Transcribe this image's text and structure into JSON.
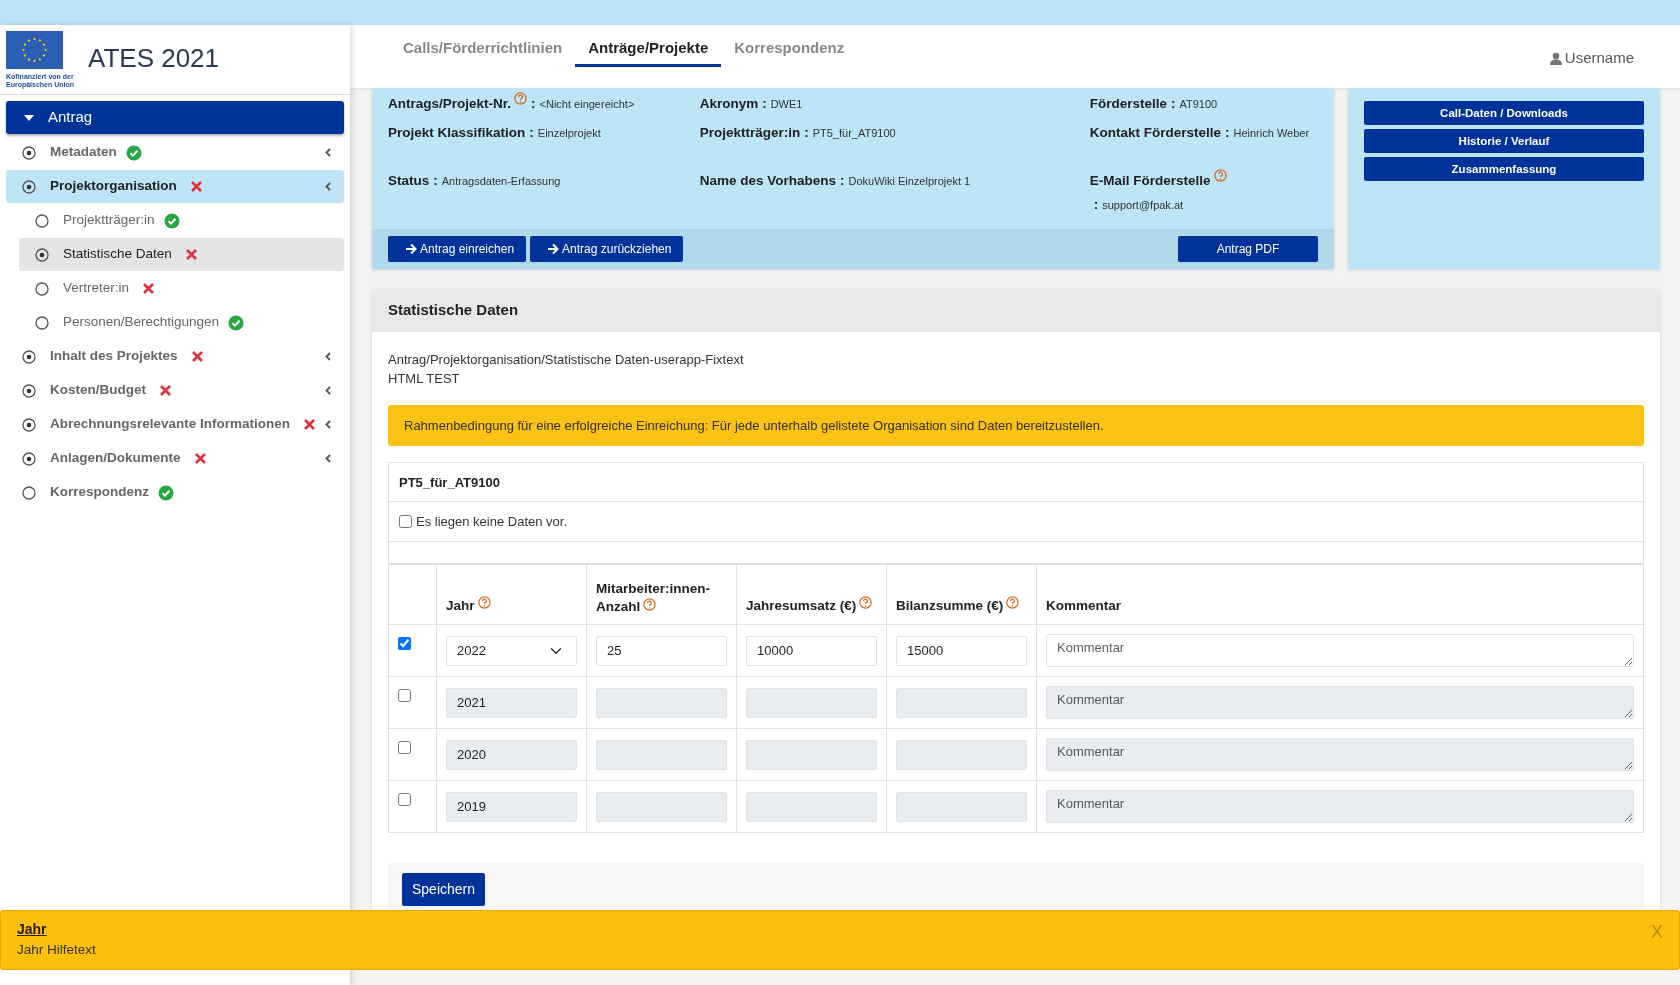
{
  "sidebar": {
    "logo_caption": "Kofinanziert von der Europäischen Union",
    "title": "ATES 2021",
    "section": {
      "label": "Antrag",
      "expanded": true
    },
    "items": [
      {
        "label": "Metadaten",
        "filled": true,
        "complete": true,
        "chevron": true,
        "selected": false
      },
      {
        "label": "Projektorganisation",
        "filled": true,
        "complete": false,
        "chevron": true,
        "selected": true,
        "children": [
          {
            "label": "Projektträger:in",
            "filled": false,
            "complete": true,
            "selected": false
          },
          {
            "label": "Statistische Daten",
            "filled": true,
            "complete": false,
            "selected": true
          },
          {
            "label": "Vertreter:in",
            "filled": false,
            "complete": false,
            "selected": false
          },
          {
            "label": "Personen/Berechtigungen",
            "filled": false,
            "complete": true,
            "selected": false
          }
        ]
      },
      {
        "label": "Inhalt des Projektes",
        "filled": true,
        "complete": false,
        "chevron": true,
        "selected": false
      },
      {
        "label": "Kosten/Budget",
        "filled": true,
        "complete": false,
        "chevron": true,
        "selected": false
      },
      {
        "label": "Abrechnungsrelevante Informationen",
        "filled": true,
        "complete": false,
        "chevron": true,
        "selected": false
      },
      {
        "label": "Anlagen/Dokumente",
        "filled": true,
        "complete": false,
        "chevron": true,
        "selected": false
      },
      {
        "label": "Korrespondenz",
        "filled": false,
        "complete": true,
        "chevron": false,
        "selected": false
      }
    ]
  },
  "tabs": [
    {
      "label": "Calls/Förderrichtlinien",
      "selected": false
    },
    {
      "label": "Anträge/Projekte",
      "selected": true
    },
    {
      "label": "Korrespondenz",
      "selected": false
    }
  ],
  "user": "Username",
  "info": {
    "columns": [
      [
        {
          "label": "Antrags/Projekt-Nr.",
          "help": true,
          "colon": ":",
          "value": "<Nicht eingereicht>"
        },
        {
          "label": "Projekt Klassifikation",
          "help": false,
          "colon": ":",
          "value": "Einzelprojekt"
        },
        {
          "label": "Status",
          "help": false,
          "colon": ":",
          "value": "Antragsdaten-Erfassung"
        }
      ],
      [
        {
          "label": "Akronym",
          "help": false,
          "colon": ":",
          "value": "DWE1"
        },
        {
          "label": "Projektträger:in",
          "help": false,
          "colon": ":",
          "value": "PT5_für_AT9100"
        },
        {
          "label": "Name des Vorhabens",
          "help": false,
          "colon": ":",
          "value": "DokuWiki Einzelprojekt 1"
        }
      ],
      [
        {
          "label": "Förderstelle",
          "help": false,
          "colon": ":",
          "value": "AT9100"
        },
        {
          "label": "Kontakt Förderstelle",
          "help": false,
          "colon": ":",
          "value": "Heinrich Weber"
        },
        {
          "label": "E-Mail Förderstelle",
          "help": true,
          "colon": ":",
          "value": "support@fpak.at"
        }
      ]
    ],
    "actions": [
      {
        "label": "Antrag einreichen",
        "arrow": true
      },
      {
        "label": "Antrag zurückziehen",
        "arrow": true
      }
    ],
    "pdf_button": "Antrag PDF"
  },
  "side_buttons": [
    "Call-Daten / Downloads",
    "Historie / Verlauf",
    "Zusammenfassung"
  ],
  "panel": {
    "title": "Statistische Daten",
    "path": "Antrag/Projektorganisation/Statistische Daten-userapp-Fixtext",
    "html_test": "HTML TEST",
    "alert": "Rahmenbedingung für eine erfolgreiche Einreichung: Für jede unterhalb gelistete Organisation sind Daten bereitzustellen.",
    "organisation": "PT5_für_AT9100",
    "no_data": {
      "label": "Es liegen keine Daten vor.",
      "checked": false
    },
    "columns": [
      {
        "label": "Jahr",
        "help": true
      },
      {
        "label": "Mitarbeiter:innen-Anzahl",
        "help": true
      },
      {
        "label": "Jahresumsatz (€)",
        "help": true
      },
      {
        "label": "Bilanzsumme (€)",
        "help": true
      },
      {
        "label": "Kommentar",
        "help": false
      }
    ],
    "rows": [
      {
        "selected": true,
        "disabled": false,
        "year": "2022",
        "employees": "25",
        "revenue": "10000",
        "balance": "15000",
        "comment_placeholder": "Kommentar"
      },
      {
        "selected": false,
        "disabled": true,
        "year": "2021",
        "comment_placeholder": "Kommentar"
      },
      {
        "selected": false,
        "disabled": true,
        "year": "2020",
        "comment_placeholder": "Kommentar"
      },
      {
        "selected": false,
        "disabled": true,
        "year": "2019",
        "comment_placeholder": "Kommentar"
      }
    ],
    "save_button": "Speichern"
  },
  "toast": {
    "title": "Jahr",
    "text": "Jahr Hilfetext",
    "close": "X"
  }
}
